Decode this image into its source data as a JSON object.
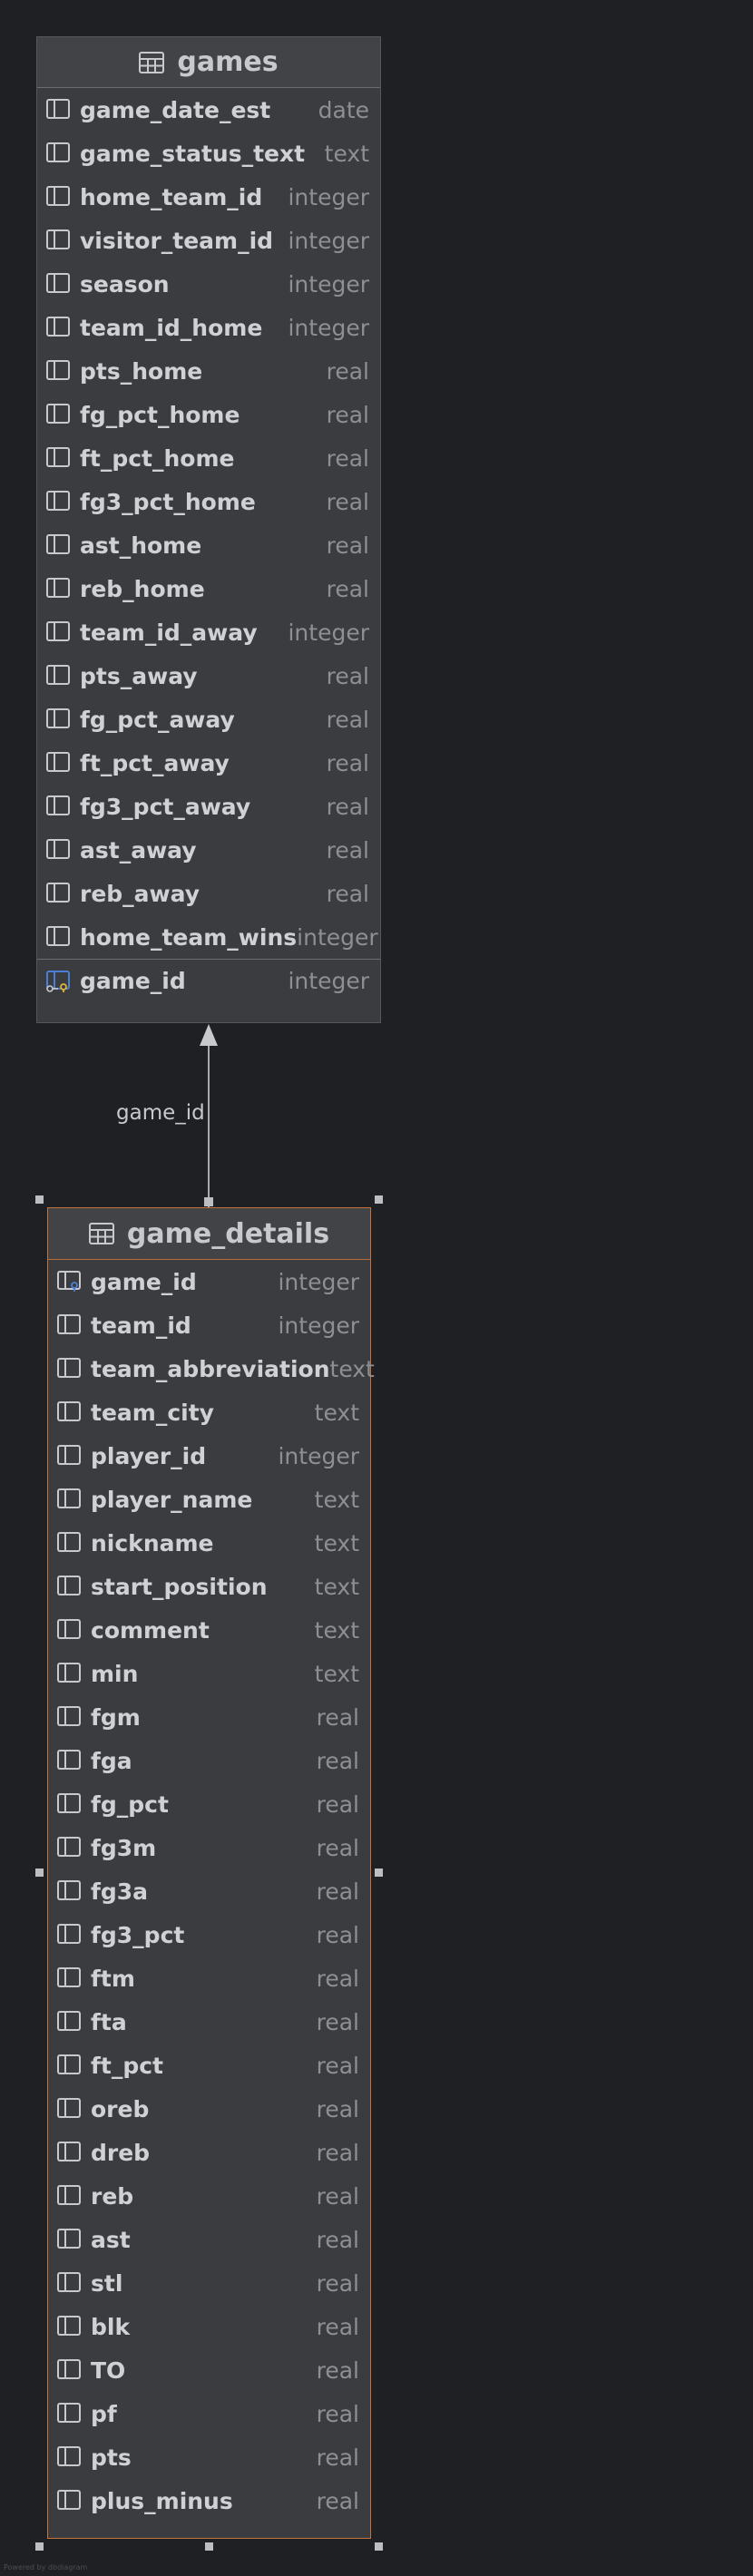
{
  "relationship": {
    "label": "game_id"
  },
  "watermark": "Powered by dbdiagram",
  "colors": {
    "background": "#1f2024",
    "table_bg": "#3b3c3f",
    "selected_border": "#c4733a",
    "column_name": "#d0d1d4",
    "column_type": "#8d8f93"
  },
  "games": {
    "title": "games",
    "columns": [
      {
        "name": "game_date_est",
        "type": "date"
      },
      {
        "name": "game_status_text",
        "type": "text"
      },
      {
        "name": "home_team_id",
        "type": "integer"
      },
      {
        "name": "visitor_team_id",
        "type": "integer"
      },
      {
        "name": "season",
        "type": "integer"
      },
      {
        "name": "team_id_home",
        "type": "integer"
      },
      {
        "name": "pts_home",
        "type": "real"
      },
      {
        "name": "fg_pct_home",
        "type": "real"
      },
      {
        "name": "ft_pct_home",
        "type": "real"
      },
      {
        "name": "fg3_pct_home",
        "type": "real"
      },
      {
        "name": "ast_home",
        "type": "real"
      },
      {
        "name": "reb_home",
        "type": "real"
      },
      {
        "name": "team_id_away",
        "type": "integer"
      },
      {
        "name": "pts_away",
        "type": "real"
      },
      {
        "name": "fg_pct_away",
        "type": "real"
      },
      {
        "name": "ft_pct_away",
        "type": "real"
      },
      {
        "name": "fg3_pct_away",
        "type": "real"
      },
      {
        "name": "ast_away",
        "type": "real"
      },
      {
        "name": "reb_away",
        "type": "real"
      },
      {
        "name": "home_team_wins",
        "type": "integer"
      }
    ],
    "key_column": {
      "name": "game_id",
      "type": "integer"
    }
  },
  "game_details": {
    "title": "game_details",
    "columns": [
      {
        "name": "game_id",
        "type": "integer",
        "icon": "foreign-key-column-icon"
      },
      {
        "name": "team_id",
        "type": "integer"
      },
      {
        "name": "team_abbreviation",
        "type": "text"
      },
      {
        "name": "team_city",
        "type": "text"
      },
      {
        "name": "player_id",
        "type": "integer"
      },
      {
        "name": "player_name",
        "type": "text"
      },
      {
        "name": "nickname",
        "type": "text"
      },
      {
        "name": "start_position",
        "type": "text"
      },
      {
        "name": "comment",
        "type": "text"
      },
      {
        "name": "min",
        "type": "text"
      },
      {
        "name": "fgm",
        "type": "real"
      },
      {
        "name": "fga",
        "type": "real"
      },
      {
        "name": "fg_pct",
        "type": "real"
      },
      {
        "name": "fg3m",
        "type": "real"
      },
      {
        "name": "fg3a",
        "type": "real"
      },
      {
        "name": "fg3_pct",
        "type": "real"
      },
      {
        "name": "ftm",
        "type": "real"
      },
      {
        "name": "fta",
        "type": "real"
      },
      {
        "name": "ft_pct",
        "type": "real"
      },
      {
        "name": "oreb",
        "type": "real"
      },
      {
        "name": "dreb",
        "type": "real"
      },
      {
        "name": "reb",
        "type": "real"
      },
      {
        "name": "ast",
        "type": "real"
      },
      {
        "name": "stl",
        "type": "real"
      },
      {
        "name": "blk",
        "type": "real"
      },
      {
        "name": "TO",
        "type": "real"
      },
      {
        "name": "pf",
        "type": "real"
      },
      {
        "name": "pts",
        "type": "real"
      },
      {
        "name": "plus_minus",
        "type": "real"
      }
    ]
  }
}
